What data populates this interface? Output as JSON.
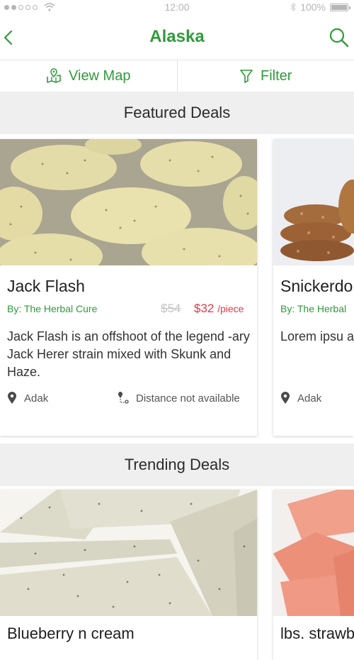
{
  "status_bar": {
    "time": "12:00",
    "battery": "100%"
  },
  "header": {
    "title": "Alaska",
    "back_icon": "chevron-left-icon",
    "search_icon": "search-icon"
  },
  "actions": {
    "view_map": {
      "label": "View Map",
      "icon": "map-icon"
    },
    "filter": {
      "label": "Filter",
      "icon": "filter-icon"
    }
  },
  "featured": {
    "heading": "Featured Deals",
    "cards": [
      {
        "title": "Jack Flash",
        "vendor": "By: The Herbal Cure",
        "price_old": "$54",
        "price_new": "$32",
        "price_unit": "/piece",
        "description": "Jack Flash is an offshoot of the legend -ary Jack Herer strain mixed with Skunk and Haze.",
        "location": "Adak",
        "distance": "Distance not available"
      },
      {
        "title": "Snickerdo",
        "vendor": "By: The Herbal",
        "description": "Lorem ipsu adipiscing e quis felis",
        "location": "Adak"
      }
    ]
  },
  "trending": {
    "heading": "Trending Deals",
    "cards": [
      {
        "title": "Blueberry n cream"
      },
      {
        "title": "lbs. strawb"
      }
    ]
  },
  "colors": {
    "accent": "#2e9b3a",
    "price": "#e53946",
    "section_bg": "#efefef"
  }
}
